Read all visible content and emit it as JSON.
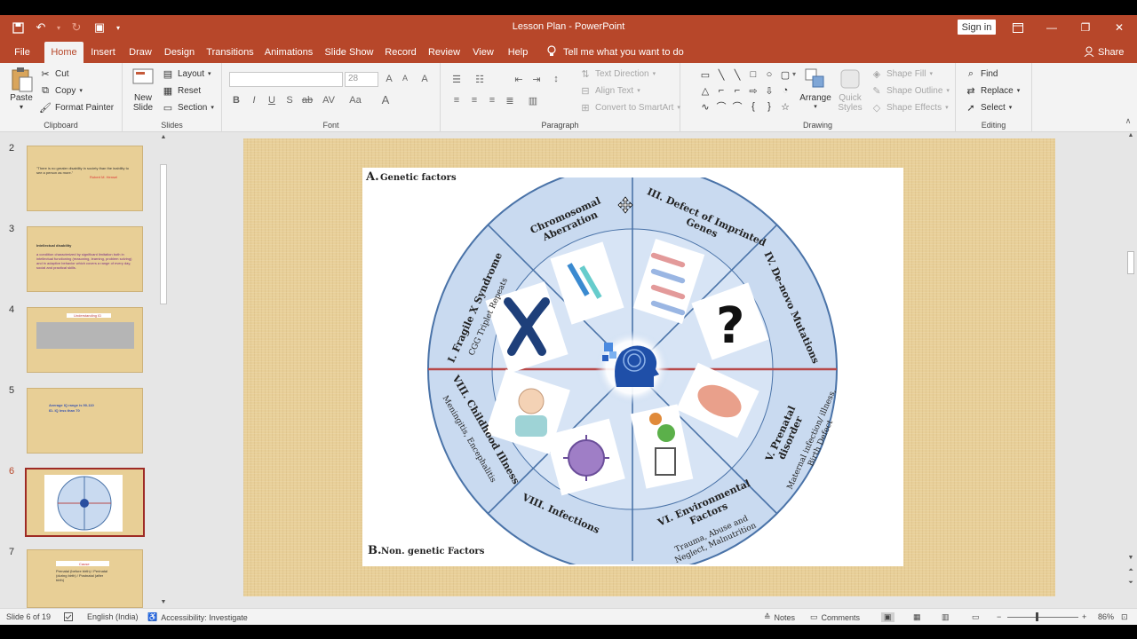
{
  "window": {
    "title": "Lesson Plan  -  PowerPoint",
    "sign_in": "Sign in",
    "share": "Share"
  },
  "tabs": [
    {
      "label": "File"
    },
    {
      "label": "Home"
    },
    {
      "label": "Insert"
    },
    {
      "label": "Draw"
    },
    {
      "label": "Design"
    },
    {
      "label": "Transitions"
    },
    {
      "label": "Animations"
    },
    {
      "label": "Slide Show"
    },
    {
      "label": "Record"
    },
    {
      "label": "Review"
    },
    {
      "label": "View"
    },
    {
      "label": "Help"
    }
  ],
  "tell_me": "Tell me what you want to do",
  "ribbon": {
    "clipboard": {
      "paste": "Paste",
      "cut": "Cut",
      "copy": "Copy",
      "format_painter": "Format Painter",
      "label": "Clipboard"
    },
    "slides": {
      "new_slide_1": "New",
      "new_slide_2": "Slide",
      "layout": "Layout",
      "reset": "Reset",
      "section": "Section",
      "label": "Slides"
    },
    "font": {
      "size": "28",
      "label": "Font"
    },
    "paragraph": {
      "text_direction": "Text Direction",
      "align_text": "Align Text",
      "convert": "Convert to SmartArt",
      "label": "Paragraph"
    },
    "drawing": {
      "arrange": "Arrange",
      "quick_styles_1": "Quick",
      "quick_styles_2": "Styles",
      "shape_fill": "Shape Fill",
      "shape_outline": "Shape Outline",
      "shape_effects": "Shape Effects",
      "label": "Drawing"
    },
    "editing": {
      "find": "Find",
      "replace": "Replace",
      "select": "Select",
      "label": "Editing"
    }
  },
  "thumbnails": [
    {
      "num": "2",
      "line1": "\"There is no greater disability in society than the inability to see a person as more.\"",
      "line2": "Robert M. Hensel"
    },
    {
      "num": "3",
      "line1": "Intellectual disability",
      "line2": "a condition characterized by significant limitation both in intellectual functioning (reasoning, learning, problem solving) and in adaptive behavior which covers a range of every day, social and practical skills."
    },
    {
      "num": "4",
      "line1": "Understanding ID",
      "line2": ""
    },
    {
      "num": "5",
      "line1": "Average IQ range is 90-110",
      "line2": "ID- IQ less than 70"
    },
    {
      "num": "6",
      "line1": "",
      "line2": ""
    },
    {
      "num": "7",
      "line1": "Cause",
      "line2": "Prenatal (before birth) / Perinatal (during birth) / Postnatal (after birth)"
    }
  ],
  "slide": {
    "heading_a_letter": "A.",
    "heading_a": "Genetic factors",
    "heading_b_letter": "B.",
    "heading_b": "Non. genetic Factors",
    "segments": [
      {
        "title": "Chromosomal Aberration",
        "sub": ""
      },
      {
        "title": "III. Defect of Imprinted Genes",
        "sub": ""
      },
      {
        "title": "IV. De-novo Mutations",
        "sub": ""
      },
      {
        "title": "V. Prenatal disorder",
        "sub": "Maternal infection/ illness, Birth Defect"
      },
      {
        "title": "VI. Environmental Factors",
        "sub": "Trauma, Abuse and Neglect, Malnutrition"
      },
      {
        "title": "VII. Infections",
        "sub": ""
      },
      {
        "title": "VIII. Childhood Illness",
        "sub": "Meningitis, Encephalitis"
      },
      {
        "title": "I. Fragile X Syndrome",
        "sub": "CGG Triplet Repeats"
      }
    ]
  },
  "status": {
    "slide_info": "Slide 6 of 19",
    "language": "English (India)",
    "accessibility": "Accessibility: Investigate",
    "notes": "Notes",
    "comments": "Comments",
    "zoom": "86%"
  },
  "colors": {
    "accent": "#b7472a",
    "wheel_fill": "#c9daf0",
    "wheel_stroke": "#4a73a8",
    "divider": "#b84848"
  }
}
